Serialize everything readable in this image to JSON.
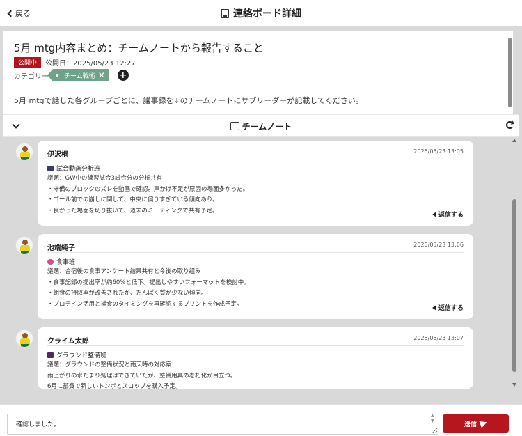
{
  "header": {
    "back_label": "戻る",
    "title": "連絡ボード詳細"
  },
  "post": {
    "title": "5月 mtg内容まとめ：チームノートから報告すること",
    "status_badge": "公開中",
    "published": "公開日：2025/05/23 12:27",
    "category_label": "カテゴリー",
    "category_tag": "チーム戦術",
    "add_symbol": "+",
    "body": "5月 mtgで話した各グループごとに、議事録を↓のチームノートにサブリーダーが記載してください。"
  },
  "note_bar": {
    "title": "チームノート"
  },
  "entries": [
    {
      "author": "伊沢桐",
      "time": "2025/05/23 13:05",
      "group": "試合動画分析班",
      "group_icon": "team-icon",
      "lines": [
        "議題：GW中の練習試合3試合分の分析共有",
        "・守備のブロックのズレを動画で確認。声かけ不足が原因の場面多かった。",
        "・ゴール前での崩しに関して、中央に偏りすぎている傾向あり。",
        "・良かった場面を切り抜いて、週末のミーティングで共有予定。"
      ],
      "reply": "返信する"
    },
    {
      "author": "池端純子",
      "time": "2025/05/23 13:06",
      "group": "食事班",
      "group_icon": "food-icon",
      "lines": [
        "議題：合宿後の食事アンケート結果共有と今後の取り組み",
        "・食事記録の提出率が約60%と低下。提出しやすいフォーマットを検討中。",
        "・朝食の摂取率が改善されたが、たんぱく質が少ない傾向。",
        "・プロテイン活用と補食のタイミングを再確認するプリントを作成予定。"
      ],
      "reply": "返信する"
    },
    {
      "author": "クライム太郎",
      "time": "2025/05/23 13:07",
      "group": "グラウンド整備班",
      "group_icon": "ground-icon",
      "lines": [
        "議題：グラウンドの整備状況と雨天時の対応案",
        "雨上がりの水たまり処理はできていたが、整備用具の老朽化が目立つ。",
        "6月に部費で新しいトンボとスコップを購入予定。"
      ],
      "reply": ""
    }
  ],
  "composer": {
    "value": "確認しました。",
    "send_label": "送信"
  }
}
